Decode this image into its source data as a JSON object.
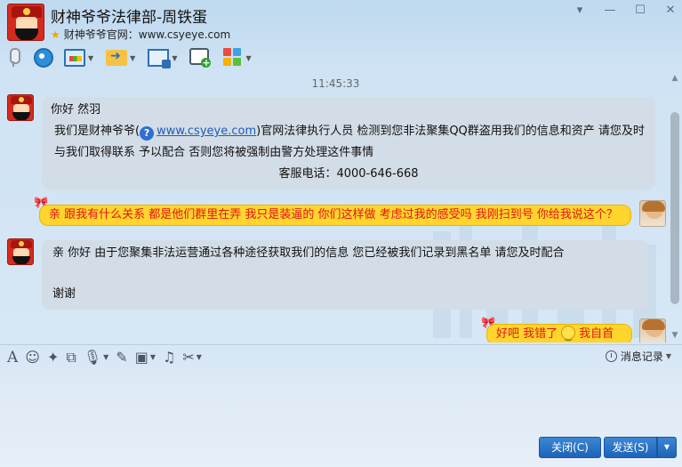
{
  "window": {
    "title": "财神爷爷法律部-周铁蛋",
    "subtitle": "财神爷爷官网：www.csyeye.com",
    "controls": [
      "▾",
      "—",
      "☐",
      "✕"
    ]
  },
  "toolbar": {
    "buttons": [
      "mic-icon",
      "camera-icon",
      "screen-icon",
      "file-transfer-icon",
      "remote-desktop-icon",
      "create-group-icon",
      "apps-icon"
    ]
  },
  "chat": {
    "timestamp": "11:45:33",
    "messages": [
      {
        "sender": "contact",
        "lines": [
          "你好 然羽",
          "我们是财神爷爷(",
          "www.csyeye.com",
          ")官网法律执行人员 检测到您非法聚集QQ群盗用我们的信息和资产 请您及时",
          "与我们取得联系 予以配合 否则您将被强制由警方处理这件事情",
          "客服电话：4000-646-668"
        ]
      },
      {
        "sender": "self",
        "text": "亲 跟我有什么关系 都是他们群里在弄 我只是装逼的 你们这样做 考虑过我的感受吗 我刚扫到号  你给我说这个？"
      },
      {
        "sender": "contact",
        "lines": [
          "亲 你好 由于您聚集非法运营通过各种途径获取我们的信息 您已经被我们记录到黑名单 请您及时配合",
          "谢谢"
        ]
      },
      {
        "sender": "self",
        "text_before": "好吧 我错了",
        "text_after": "我自首"
      }
    ]
  },
  "input_toolbar": {
    "history_label": "消息记录"
  },
  "buttons": {
    "close_label": "关闭(C)",
    "send_label": "发送(S)"
  },
  "colors": {
    "self_bubble": "#ffd52e",
    "self_text": "#e01515",
    "contact_bubble": "#d3dde7",
    "button": "#1e63b8"
  }
}
